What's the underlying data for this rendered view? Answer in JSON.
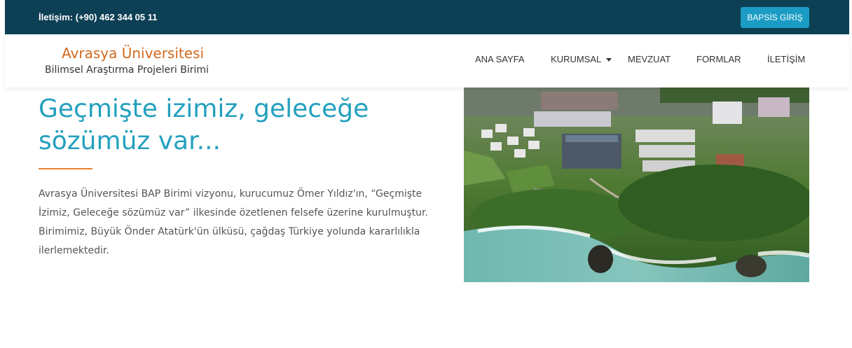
{
  "topbar": {
    "contact": "İletişim: (+90) 462 344 05 11",
    "bapsis_button": "BAPSİS GİRİŞ"
  },
  "header": {
    "logo_title": "Avrasya Üniversitesi",
    "logo_subtitle": "Bilimsel Araştırma Projeleri Birimi"
  },
  "nav": {
    "items": [
      {
        "label": "ANA SAYFA"
      },
      {
        "label": "KURUMSAL",
        "dropdown": true
      },
      {
        "label": "MEVZUAT"
      },
      {
        "label": "FORMLAR"
      },
      {
        "label": "İLETİŞİM"
      }
    ]
  },
  "hero": {
    "heading_line1": "Geçmişte izimiz, geleceğe",
    "heading_line2": "sözümüz var...",
    "paragraph": "Avrasya Üniversitesi BAP Birimi vizyonu, kurucumuz Ömer Yıldız'ın, “Geçmişte İzimiz, Geleceğe sözümüz var” ilkesinde özetlenen felsefe üzerine kurulmuştur. Birimimiz, Büyük Önder Atatürk'ün ülküsü, çağdaş Türkiye yolunda kararlılıkla ilerlemektedir.",
    "image": "campus-aerial-photo"
  },
  "colors": {
    "topbar_bg": "#0d3f55",
    "button_bg": "#1a9cc4",
    "logo_orange": "#d2691e",
    "heading_teal": "#23a0bf",
    "accent_orange": "#e8802e"
  }
}
